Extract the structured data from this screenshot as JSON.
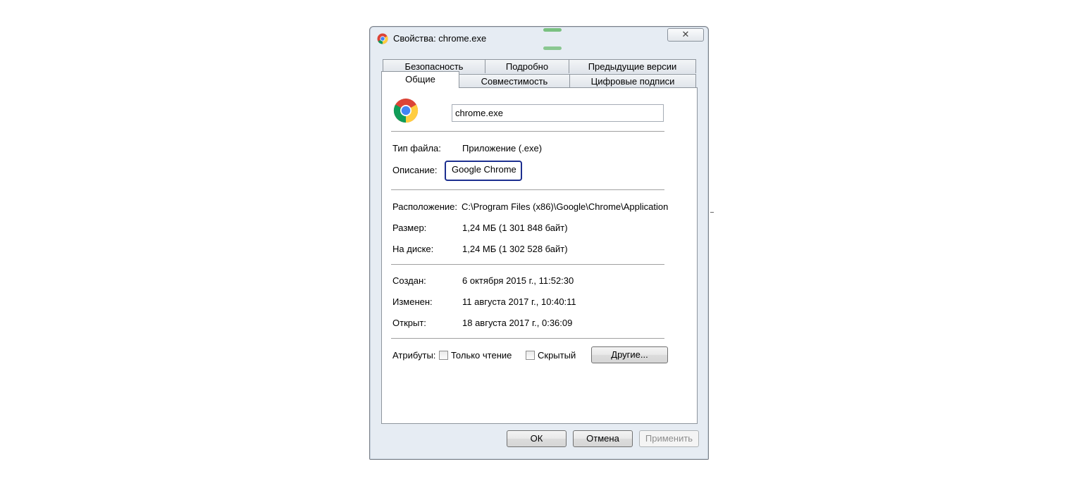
{
  "window": {
    "title": "Свойства: chrome.exe",
    "close_label": "✕"
  },
  "tabs": {
    "row_back": [
      "Безопасность",
      "Подробно",
      "Предыдущие версии"
    ],
    "row_front": [
      "Общие",
      "Совместимость",
      "Цифровые подписи"
    ],
    "active": "Общие"
  },
  "general": {
    "file_name": "chrome.exe",
    "file_type_label": "Тип файла:",
    "file_type_value": "Приложение (.exe)",
    "description_label": "Описание:",
    "description_value": "Google Chrome",
    "location_label": "Расположение:",
    "location_value": "C:\\Program Files (x86)\\Google\\Chrome\\Application",
    "size_label": "Размер:",
    "size_value": "1,24 МБ (1 301 848 байт)",
    "disk_label": "На диске:",
    "disk_value": "1,24 МБ (1 302 528 байт)",
    "created_label": "Создан:",
    "created_value": "6 октября 2015 г., 11:52:30",
    "modified_label": "Изменен:",
    "modified_value": "11 августа 2017 г., 10:40:11",
    "opened_label": "Открыт:",
    "opened_value": "18 августа 2017 г., 0:36:09",
    "attributes_label": "Атрибуты:",
    "readonly_label": "Только чтение",
    "hidden_label": "Скрытый",
    "other_button": "Другие..."
  },
  "footer": {
    "ok": "ОК",
    "cancel": "Отмена",
    "apply": "Применить"
  },
  "icons": [
    "chrome-icon",
    "close-icon",
    "checkbox-icon"
  ],
  "colors": {
    "highlight_border": "#1c2f8f",
    "window_bg": "#e6ecf3"
  }
}
